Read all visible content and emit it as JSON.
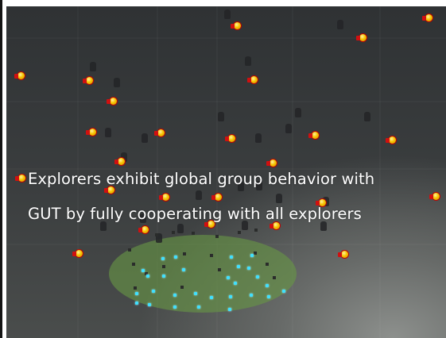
{
  "caption": {
    "line1": "Explorers exhibit global group behavior with",
    "line2": "GUT by fully cooperating with all explorers"
  },
  "colors": {
    "explorer_body": "#f7c400",
    "explorer_outline": "#c00000",
    "zone": "#689646",
    "target": "#3fe0ff"
  },
  "icons": {
    "explorer": "explorer-agent-icon",
    "shadow": "agent-shadow-icon",
    "target": "target-point-icon"
  }
}
